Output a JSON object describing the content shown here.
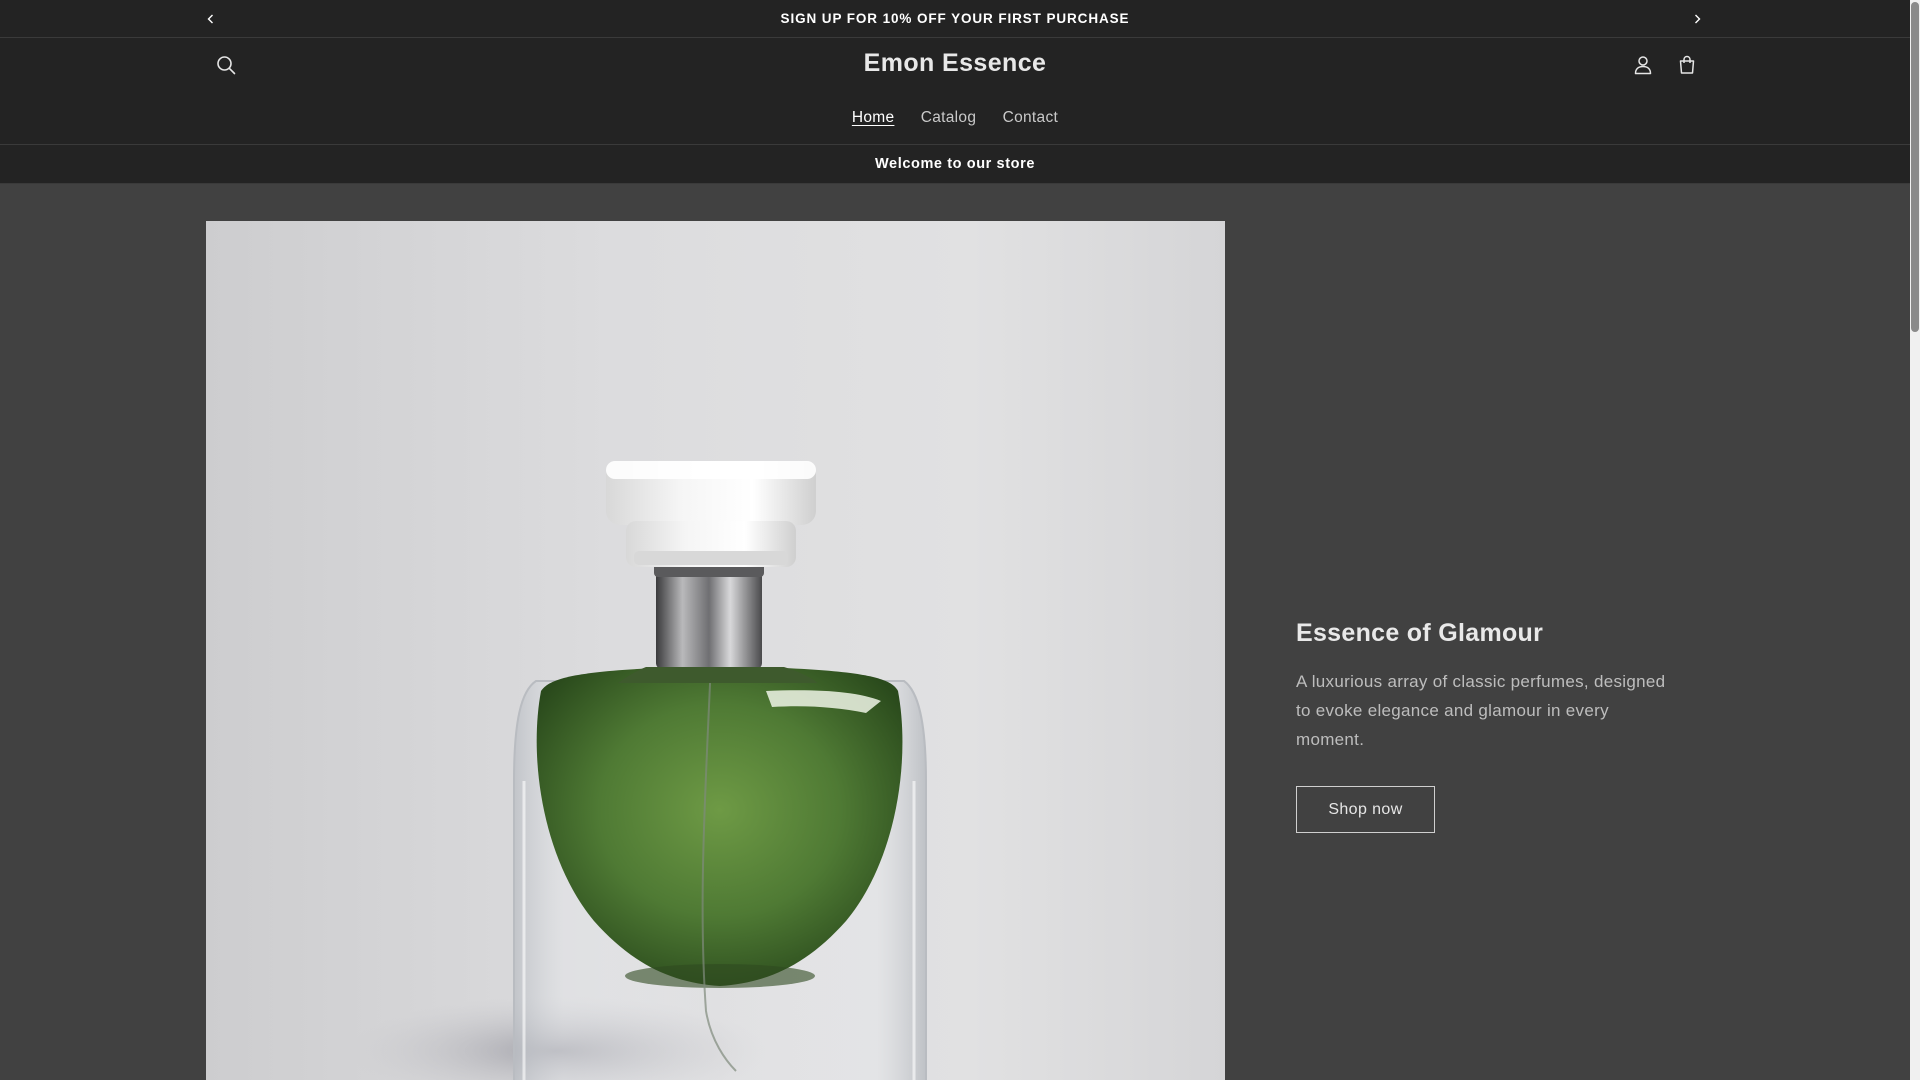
{
  "announcement": {
    "text": "SIGN UP FOR 10% OFF YOUR FIRST PURCHASE",
    "prev_icon": "chevron-left-icon",
    "next_icon": "chevron-right-icon"
  },
  "header": {
    "brand": "Emon Essence",
    "icons": {
      "search": "search-icon",
      "account": "user-icon",
      "cart": "cart-icon"
    },
    "nav": [
      {
        "label": "Home",
        "active": true
      },
      {
        "label": "Catalog",
        "active": false
      },
      {
        "label": "Contact",
        "active": false
      }
    ]
  },
  "welcome": {
    "text": "Welcome to our store"
  },
  "hero": {
    "title": "Essence of Glamour",
    "description": "A luxurious array of classic perfumes, designed to evoke elegance and glamour in every moment.",
    "button_label": "Shop now"
  },
  "colors": {
    "page_background": "#414141",
    "bar_background": "#232323",
    "text_primary": "#ffffff",
    "text_secondary": "#bdbdbd",
    "perfume_green": "#4f7a34"
  }
}
